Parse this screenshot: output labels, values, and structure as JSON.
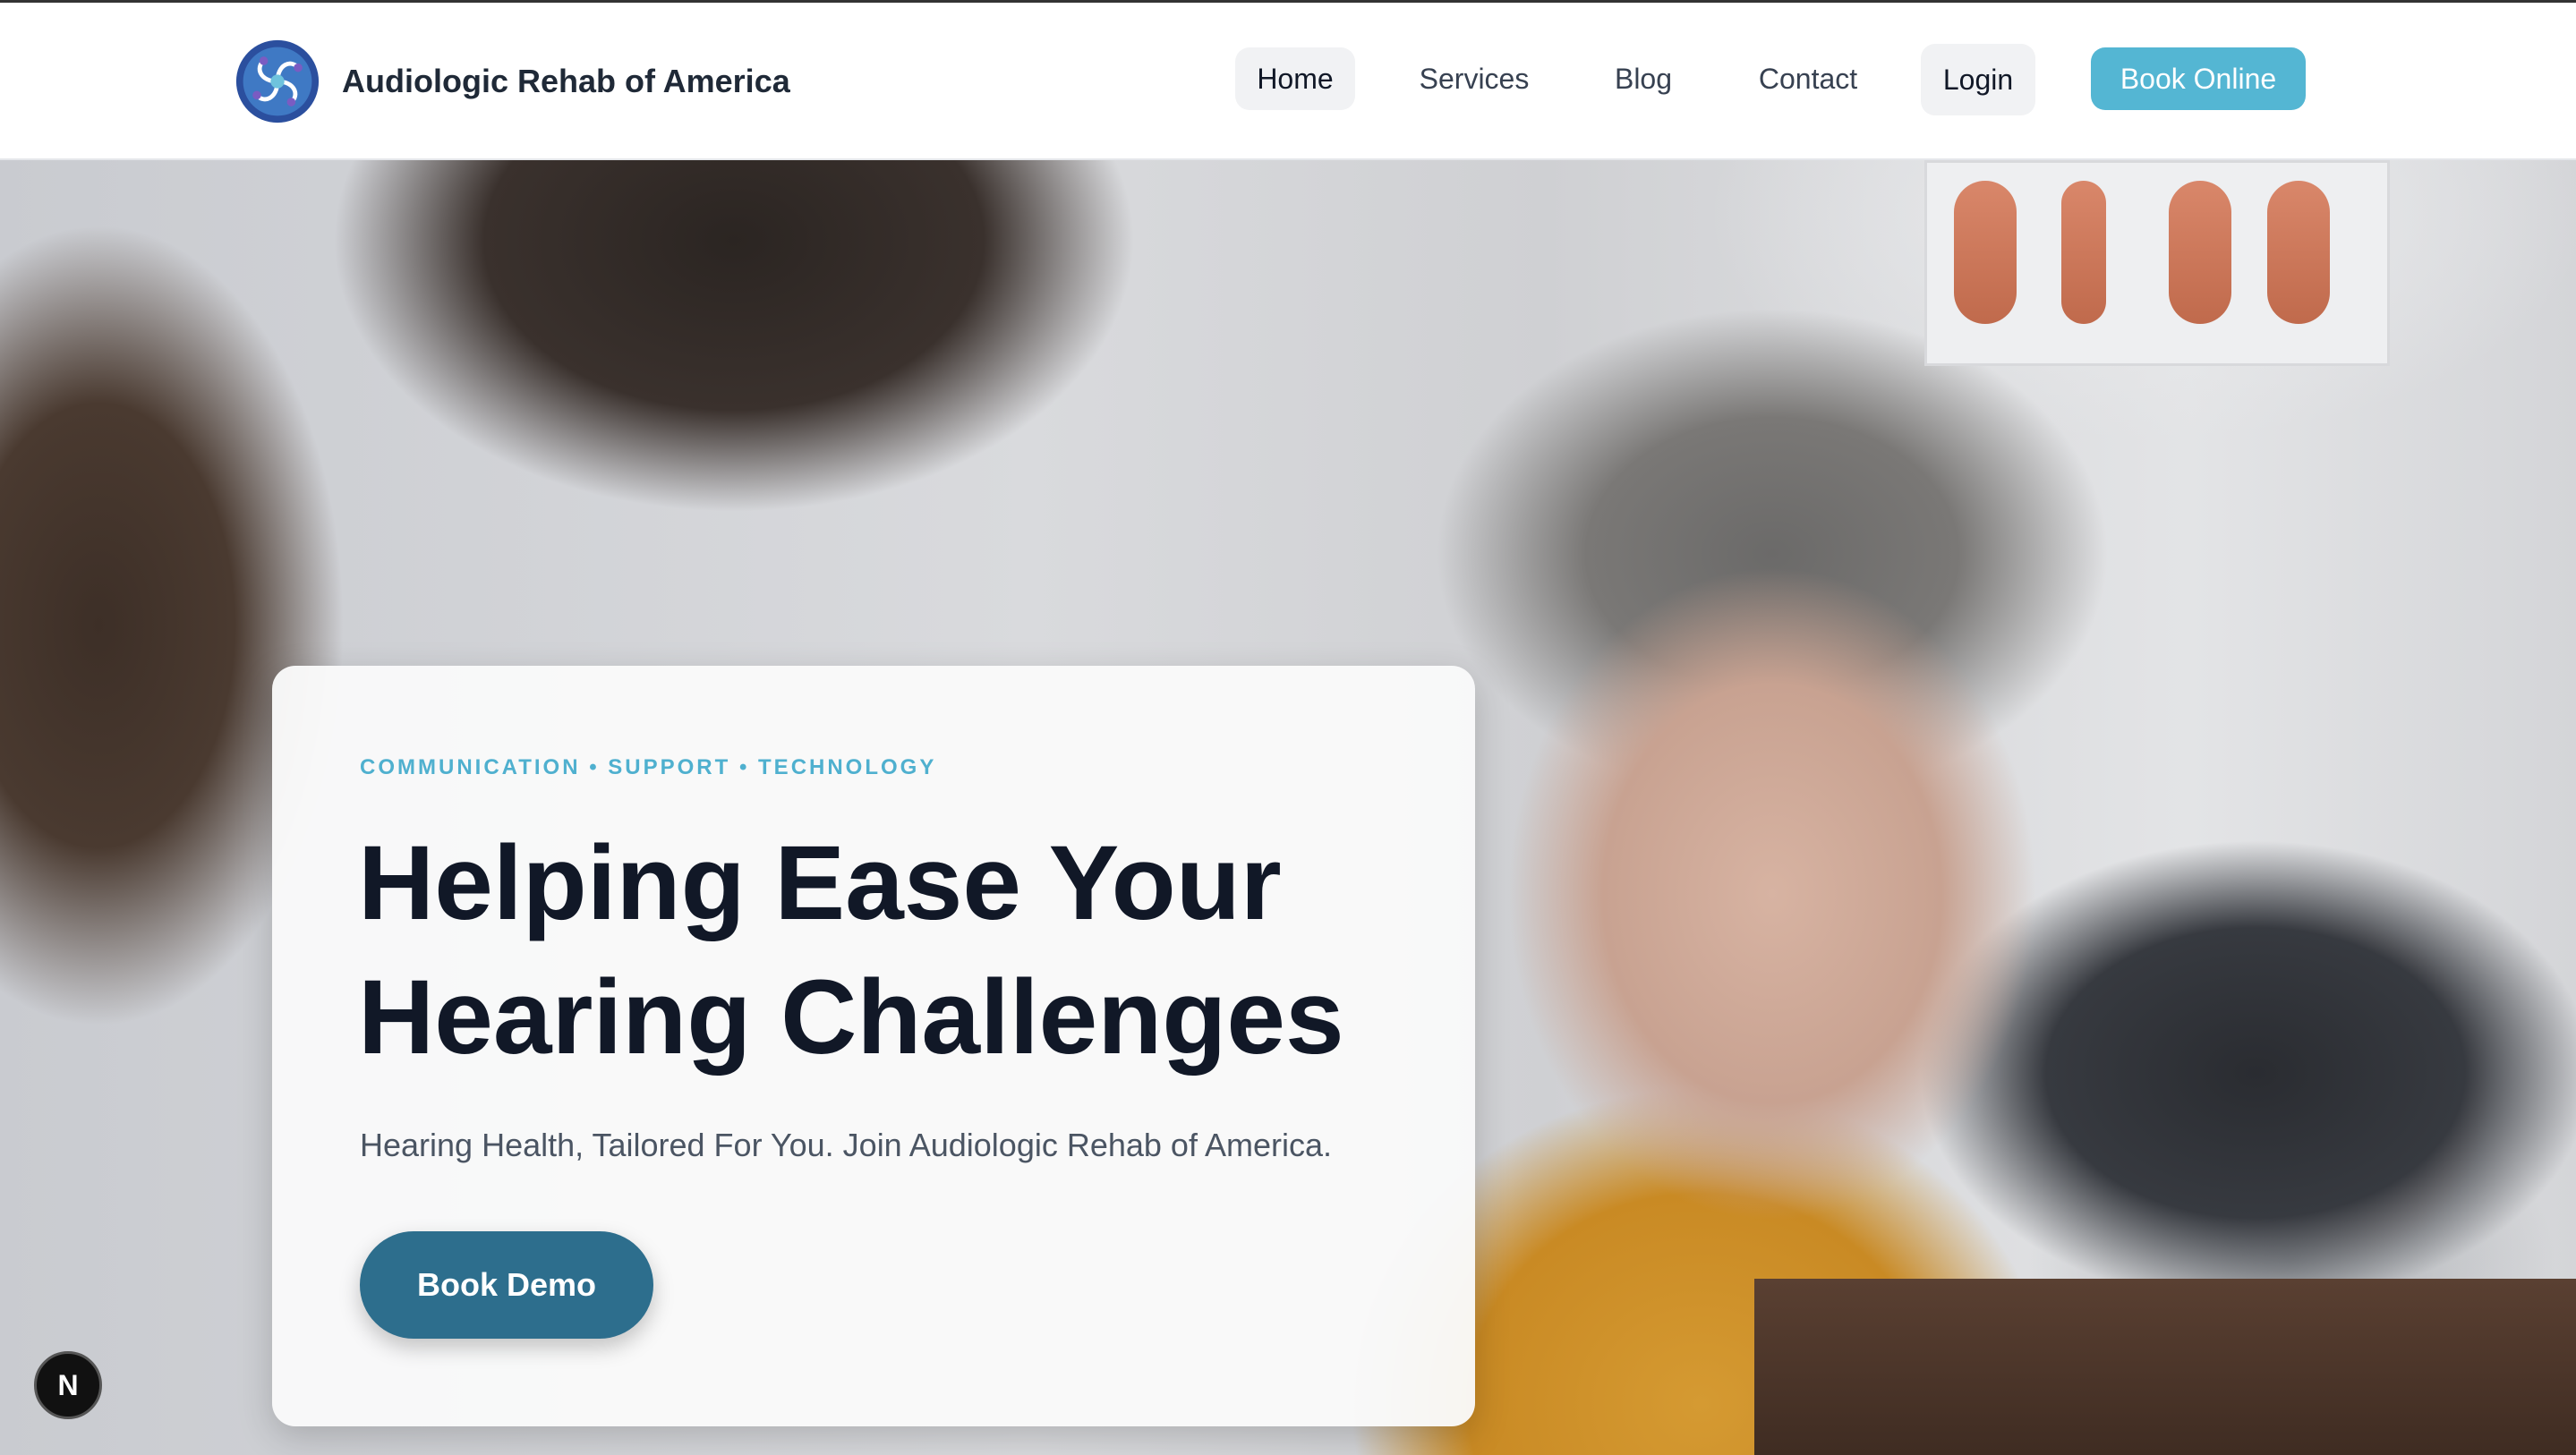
{
  "header": {
    "brand_name": "Audiologic Rehab of America",
    "nav": {
      "home": "Home",
      "services": "Services",
      "blog": "Blog",
      "contact": "Contact",
      "login": "Login",
      "book_online": "Book Online"
    }
  },
  "hero": {
    "eyebrow": "COMMUNICATION • SUPPORT • TECHNOLOGY",
    "headline_line1": "Helping Ease Your",
    "headline_line2": "Hearing Challenges",
    "subline": "Hearing Health, Tailored For You. Join Audiologic Rehab of America.",
    "cta": "Book Demo"
  },
  "dev_badge": "N",
  "colors": {
    "accent": "#54b6d3",
    "cta": "#2d6e8d",
    "headline": "#111827",
    "eyebrow": "#4fb0cf"
  },
  "icons": {
    "logo": "brand-logo-icon",
    "dev_badge": "nextjs-icon"
  }
}
